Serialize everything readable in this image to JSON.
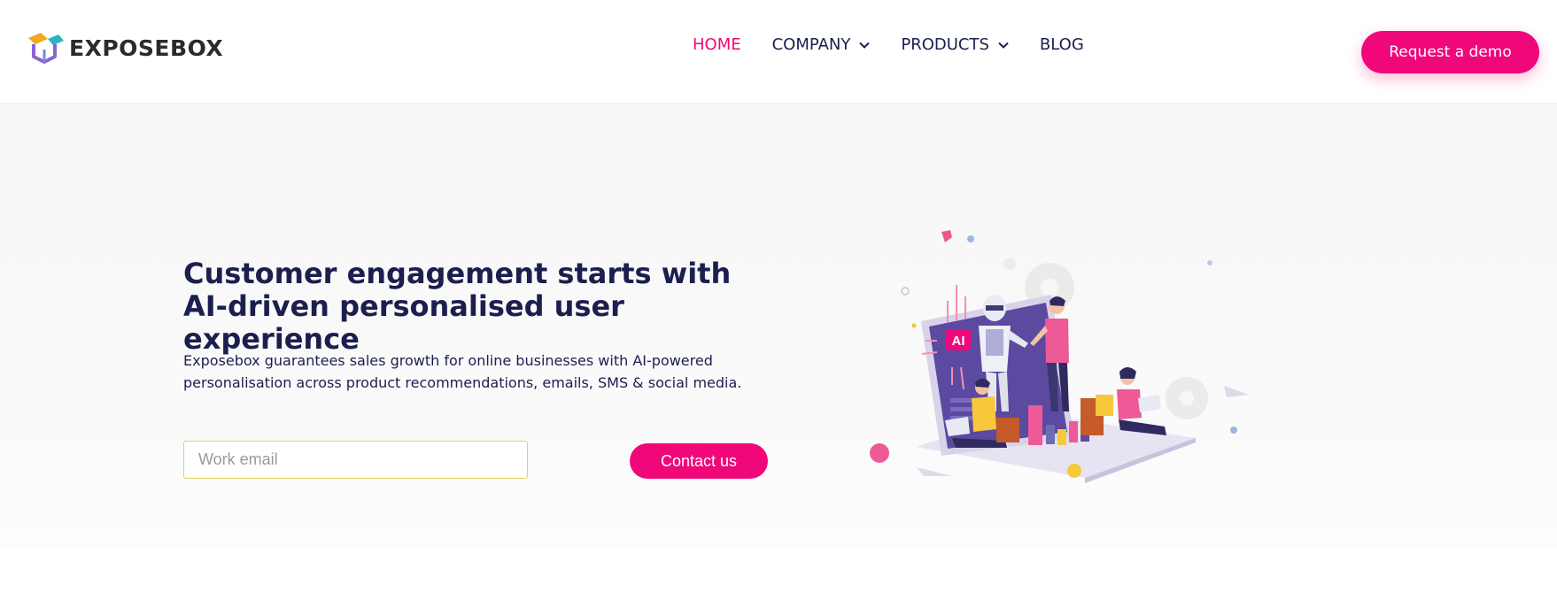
{
  "header": {
    "logo_text": "EXPOSEBOX",
    "logo_icon": "box-logo-icon",
    "nav": [
      {
        "label": "HOME",
        "active": true
      },
      {
        "label": "COMPANY",
        "dropdown": true
      },
      {
        "label": "PRODUCTS",
        "dropdown": true
      },
      {
        "label": "BLOG"
      }
    ],
    "cta_label": "Request a demo"
  },
  "hero": {
    "title": "Customer engagement starts with AI-driven personalised user experience",
    "description": "Exposebox guarantees sales growth for online businesses with AI-powered personalisation across product recommendations, emails, SMS & social media.",
    "email_placeholder": "Work email",
    "contact_label": "Contact us",
    "illustration_badge": "AI"
  },
  "colors": {
    "accent": "#f0077a",
    "text": "#1b1f4e",
    "input_border": "#e3cf63"
  }
}
